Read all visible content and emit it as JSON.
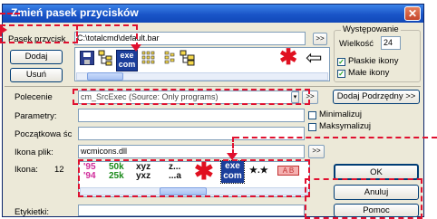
{
  "window": {
    "title": "Zmień pasek przycisków",
    "close_label": "✕"
  },
  "bar_file": {
    "label": "Pasek przycisk",
    "value": "C:\\totalcmd\\default.bar",
    "browse_label": ">>"
  },
  "buttons": {
    "add": "Dodaj",
    "delete": "Usuń",
    "add_sub": "Dodaj Podrzędny >>",
    "ok": "OK",
    "cancel": "Anuluj",
    "help": "Pomoc"
  },
  "appearance": {
    "group_label": "Występowanie",
    "size_label": "Wielkość",
    "size_value": "24",
    "flat_icons_label": "Płaskie ikony",
    "small_icons_label": "Małe ikony"
  },
  "command": {
    "label": "Polecenie",
    "value": "cm_SrcExec (Source: Only programs)",
    "browse_label": ">>"
  },
  "params": {
    "label": "Parametry:",
    "value": "",
    "minimize_label": "Minimalizuj",
    "maximize_label": "Maksymalizuj"
  },
  "start_path": {
    "label": "Początkowa ścieżka",
    "value": ""
  },
  "icon_file": {
    "label": "Ikona plik:",
    "value": "wcmicons.dll",
    "browse_label": ">>"
  },
  "icon": {
    "label": "Ikona:",
    "index": "12"
  },
  "tooltip": {
    "label": "Etykietki:",
    "value": ""
  },
  "glyphs": {
    "exe_top": "exe",
    "exe_bottom": "com",
    "star": "✱",
    "arrow": "⇦",
    "y95": "'95",
    "y94": "'94",
    "k50": "50k",
    "k25": "25k",
    "xyz": "xyz",
    "yxz": "yxz",
    "za1": "z...",
    "za2": "...a",
    "stars": "★.★",
    "ab": "A B",
    "dots": "..."
  }
}
